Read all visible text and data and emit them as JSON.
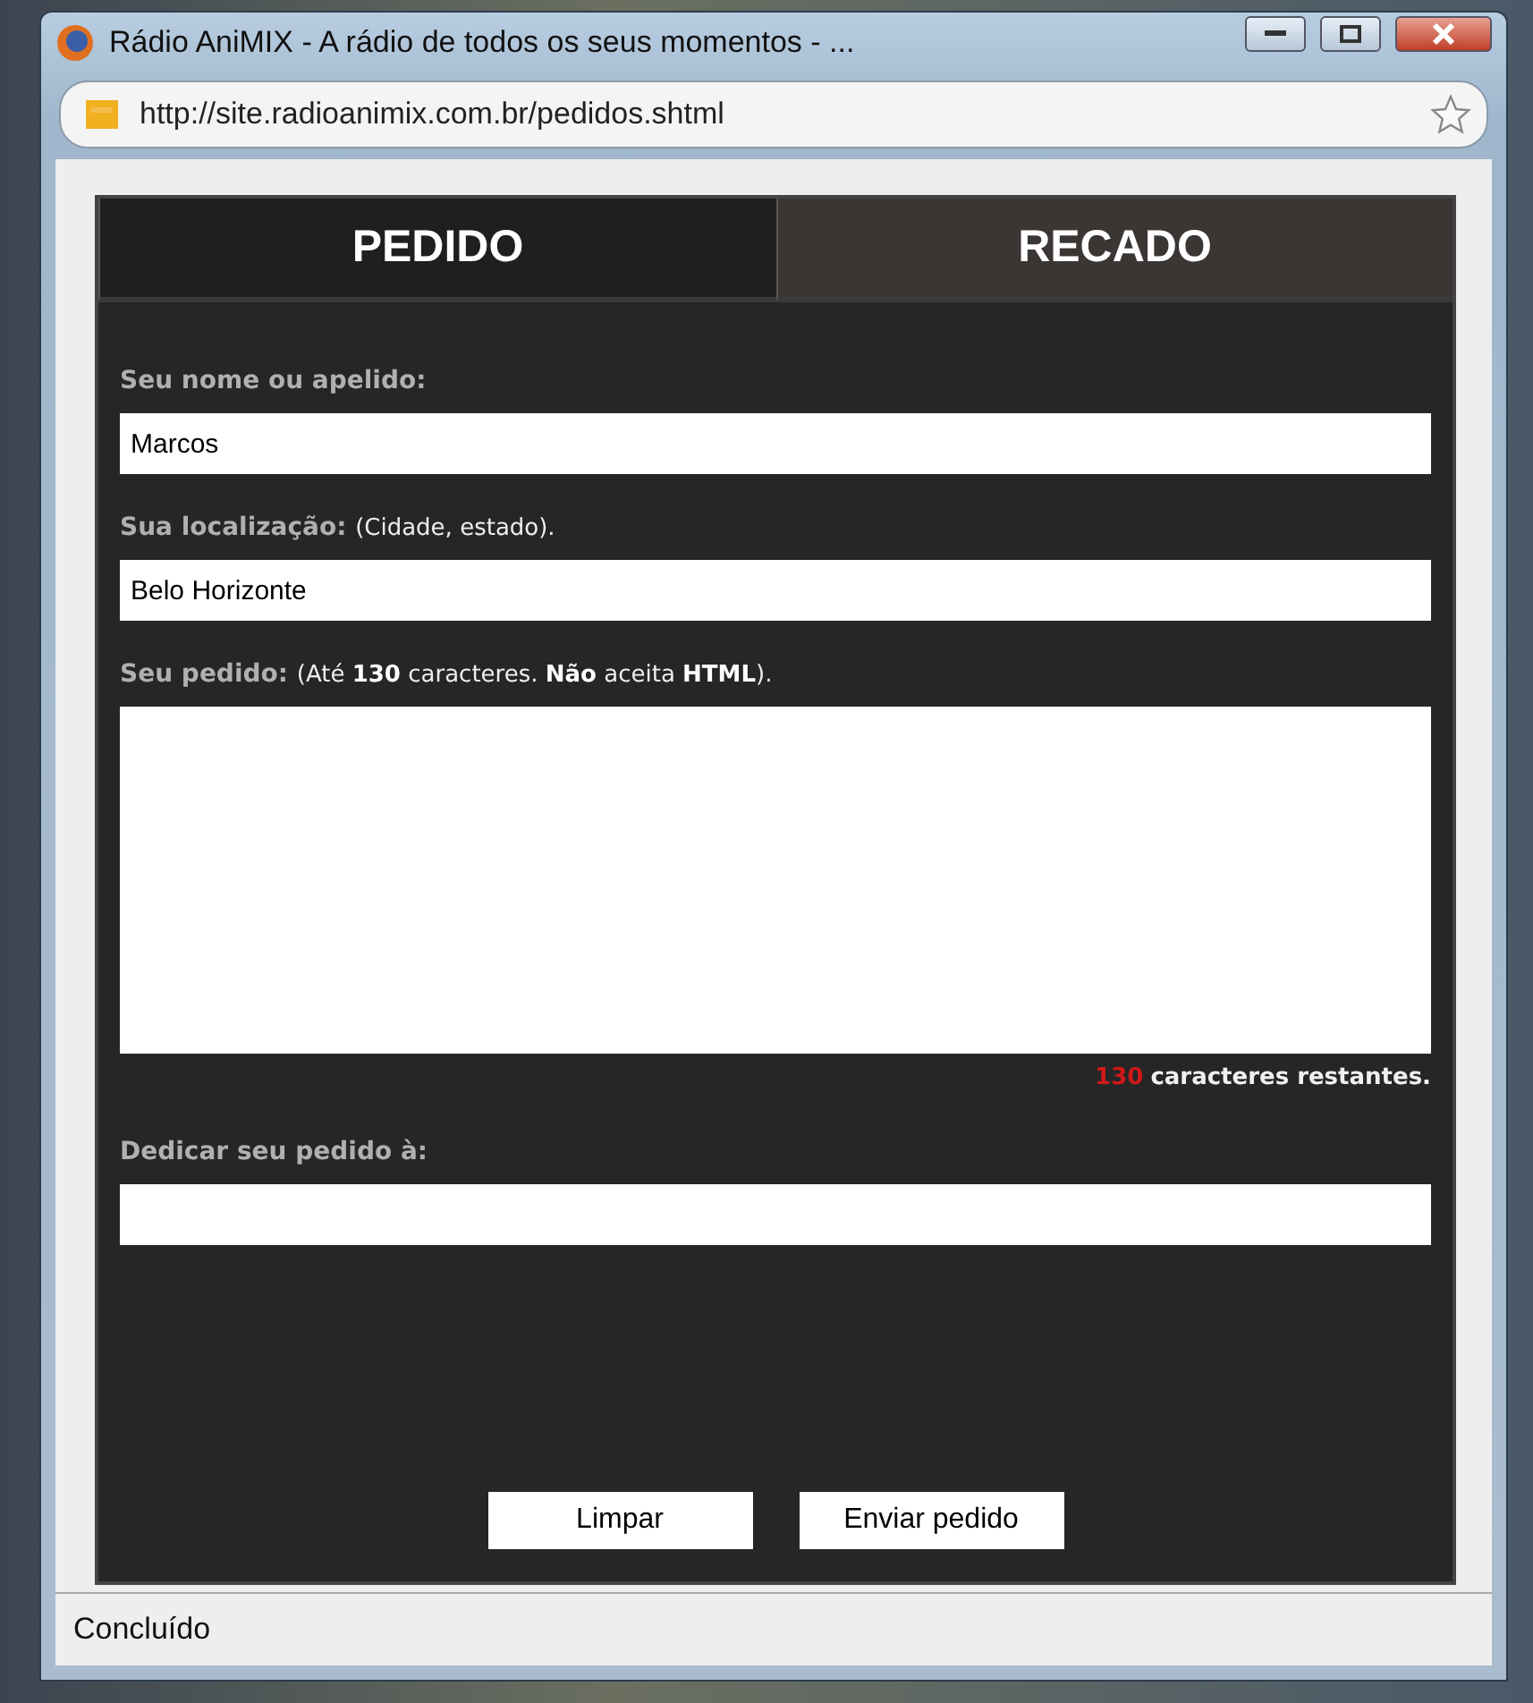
{
  "window": {
    "title": "Rádio AniMIX - A rádio de todos os seus momentos - ..."
  },
  "address_bar": {
    "url": "http://site.radioanimix.com.br/pedidos.shtml"
  },
  "tabs": [
    {
      "label": "PEDIDO",
      "selected": true
    },
    {
      "label": "RECADO",
      "selected": false
    }
  ],
  "form": {
    "fields": [
      {
        "kind": "input",
        "label": "Seu nome ou apelido:",
        "value": "Marcos"
      },
      {
        "kind": "input",
        "label": "Sua localização:",
        "hint": "(Cidade, estado).",
        "value": "Belo Horizonte"
      },
      {
        "kind": "textarea",
        "label": "Seu pedido:",
        "hint": "(Até **130** caracteres. **Não** aceita **HTML**).",
        "counter": "130",
        "counter_text": "caracteres restantes."
      },
      {
        "kind": "input",
        "label": "Dedicar seu pedido à:"
      }
    ],
    "buttons": [
      "Limpar",
      "Enviar pedido"
    ]
  },
  "status_bar": "Concluído"
}
